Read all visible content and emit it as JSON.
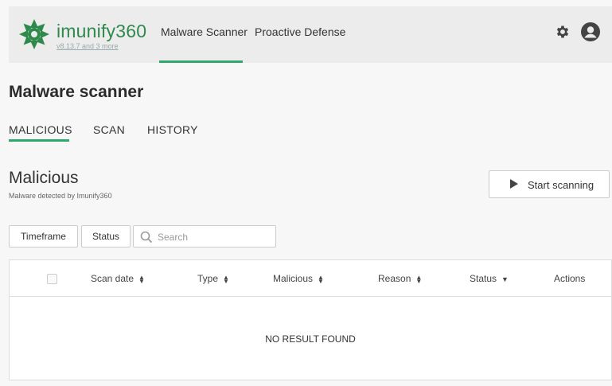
{
  "header": {
    "brand": "imunify360",
    "version": "v8.13.7 and 3 more",
    "nav": [
      {
        "label": "Malware Scanner"
      },
      {
        "label": "Proactive Defense"
      }
    ],
    "icons": {
      "settings": "gear-icon",
      "account": "user-avatar-icon"
    },
    "accent_color": "#2fa86b",
    "brand_color": "#2e8a4c"
  },
  "page": {
    "title": "Malware scanner",
    "tabs": [
      {
        "label": "MALICIOUS",
        "active": true
      },
      {
        "label": "SCAN"
      },
      {
        "label": "HISTORY"
      }
    ]
  },
  "section": {
    "title": "Malicious",
    "subtitle": "Malware detected by Imunify360",
    "start_button": "Start scanning"
  },
  "filters": {
    "timeframe": "Timeframe",
    "status": "Status",
    "search_placeholder": "Search",
    "search_value": ""
  },
  "table": {
    "columns": [
      {
        "label": "Scan date",
        "sort": "both"
      },
      {
        "label": "Type",
        "sort": "both"
      },
      {
        "label": "Malicious",
        "sort": "both"
      },
      {
        "label": "Reason",
        "sort": "both"
      },
      {
        "label": "Status",
        "sort": "down"
      },
      {
        "label": "Actions",
        "sort": "none"
      }
    ],
    "empty_text": "NO RESULT FOUND"
  }
}
